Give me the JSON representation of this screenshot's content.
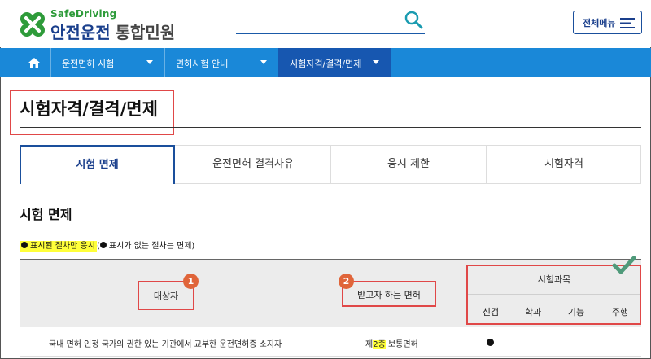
{
  "header": {
    "logo_top": "SafeDriving",
    "logo_main": "안전운전",
    "logo_sub": "통합민원",
    "search_placeholder": "",
    "all_menu_label": "전체메뉴"
  },
  "nav": {
    "home_icon": "home-icon",
    "items": [
      {
        "label": "운전면허 시험"
      },
      {
        "label": "면허시험 안내"
      },
      {
        "label": "시험자격/결격/면제"
      }
    ]
  },
  "page": {
    "title": "시험자격/결격/면제",
    "tabs": [
      {
        "label": "시험 면제"
      },
      {
        "label": "운전면허 결격사유"
      },
      {
        "label": "응시 제한"
      },
      {
        "label": "시험자격"
      }
    ],
    "section_title": "시험 면제",
    "legend_highlight": "표시된 절차만 응시",
    "legend_open": "(",
    "legend_rest": "표시가 없는 절차는 면제)"
  },
  "table": {
    "col_target": "대상자",
    "col_license": "받고자 하는 면허",
    "col_subjects": "시험과목",
    "badge_1": "1",
    "badge_2": "2",
    "subjects": [
      "신검",
      "학과",
      "기능",
      "주행"
    ],
    "rows": [
      {
        "target": "국내 면허 인정 국가의 권한 있는 기관에서 교부한 운전면허증 소지자",
        "license_pre": "제",
        "license_hl": "2종",
        "license_post": " 보통면허"
      }
    ]
  },
  "colors": {
    "brand_blue": "#1a3f8c",
    "nav_blue": "#1a88d8",
    "nav_active": "#1757b0",
    "annotation_red": "#e04848",
    "highlight": "#ffff3a"
  }
}
